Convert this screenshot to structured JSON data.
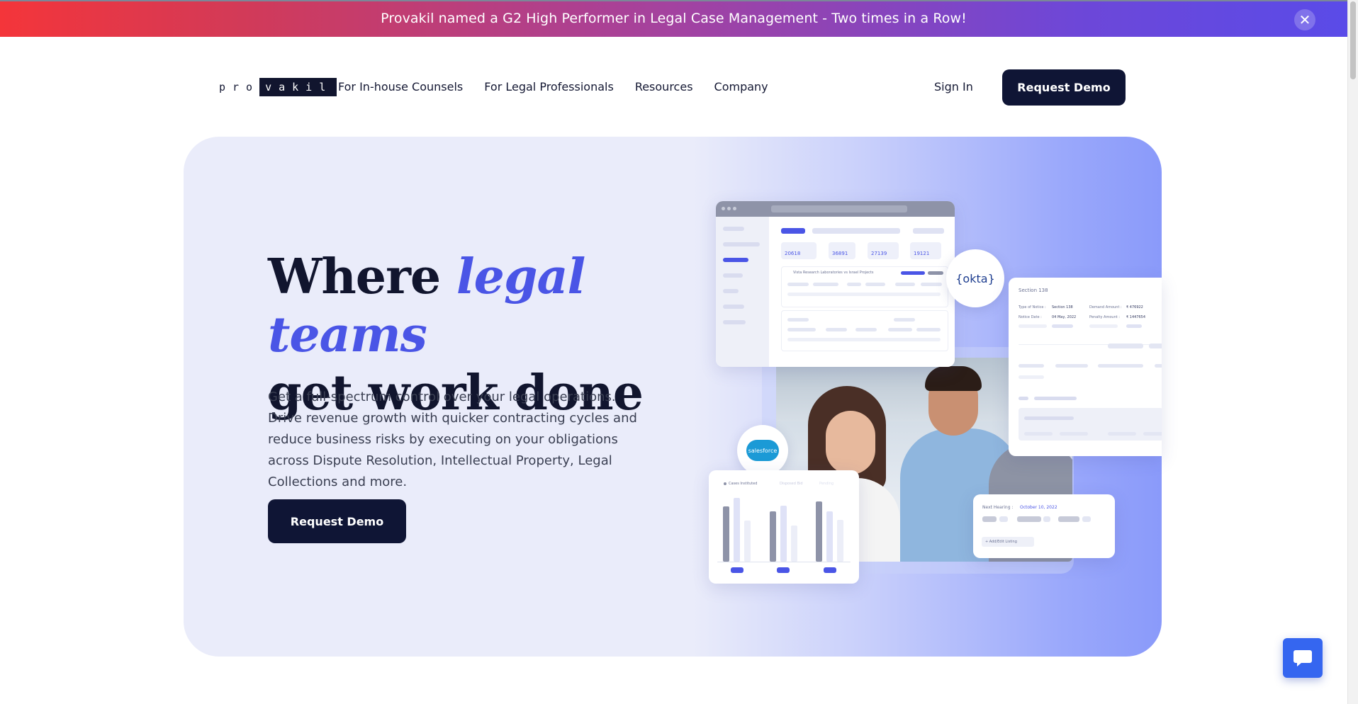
{
  "banner": {
    "text": "Provakil named a G2 High Performer in Legal Case Management - Two times in a Row!",
    "close_icon": "close-icon"
  },
  "logo": {
    "part1": "pro",
    "part2": "vakil"
  },
  "nav": {
    "items": [
      "For In-house Counsels",
      "For Legal Professionals",
      "Resources",
      "Company"
    ],
    "signin": "Sign In",
    "demo": "Request Demo"
  },
  "hero": {
    "headline_part1": "Where ",
    "headline_accent": "legal teams",
    "headline_part2": "get work done",
    "subtext": "Get a full-spectrum control over your legal operations. Drive revenue growth with quicker contracting cycles and reduce business risks by executing on your obligations across Dispute Resolution, Intellectual Property, Legal Collections and more.",
    "cta": "Request Demo"
  },
  "illustration": {
    "dashboard_stats": [
      "20618",
      "36891",
      "27139",
      "19121"
    ],
    "dashboard_row_text": "Vista Research Laboratories vs Israel Projects",
    "okta_label": "{okta}",
    "salesforce_label": "salesforce",
    "section_card": {
      "title": "Section 138",
      "type_label": "Type of Notice :",
      "type_value": "Section 138",
      "notice_label": "Notice Date :",
      "notice_value": "04 May, 2022",
      "amount_label": "Demand Amount :",
      "amount_value": "₹ 476922",
      "penalty_label": "Penalty Amount :",
      "penalty_value": "₹ 1447654"
    },
    "chart_legend": [
      "Cases Instituted",
      "Disposed Bid",
      "Pending"
    ],
    "hearing": {
      "label": "Next Hearing :",
      "date": "October 10, 2022",
      "button": "+ Add/Edit Listing"
    }
  },
  "colors": {
    "accent": "#4a55e6",
    "dark": "#0f1535",
    "hero_bg": "#eaecfa",
    "chat": "#3566f0"
  },
  "chat_icon": "chat-bubble-icon"
}
